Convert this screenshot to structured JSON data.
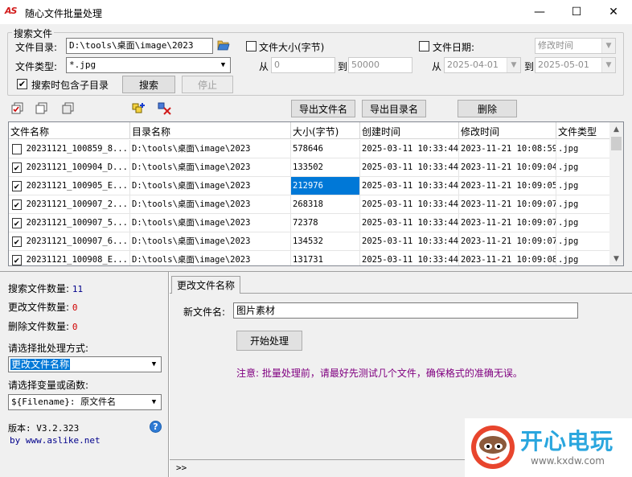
{
  "window": {
    "title": "随心文件批量处理",
    "app_icon_text": "AS",
    "minimize": "—",
    "maximize": "☐",
    "close": "✕"
  },
  "search_group": {
    "title": "搜索文件",
    "dir_label": "文件目录:",
    "dir_value": "D:\\tools\\桌面\\image\\2023",
    "type_label": "文件类型:",
    "type_value": "*.jpg",
    "subdir_label": "搜索时包含子目录",
    "subdir_checked": true,
    "search_button": "搜索",
    "stop_button": "停止",
    "size_label": "文件大小(字节)",
    "size_from_label": "从",
    "size_from_value": "0",
    "size_to_label": "到",
    "size_to_value": "50000",
    "date_label": "文件日期:",
    "date_mode_value": "修改时间",
    "date_from_label": "从",
    "date_from_value": "2025-04-01",
    "date_to_label": "到",
    "date_to_value": "2025-05-01"
  },
  "toolbar": {
    "export_files": "导出文件名",
    "export_dirs": "导出目录名",
    "delete": "删除"
  },
  "table": {
    "headers": [
      "文件名称",
      "目录名称",
      "大小(字节)",
      "创建时间",
      "修改时间",
      "文件类型"
    ],
    "rows": [
      {
        "checked": false,
        "name": "20231121_100859_8...",
        "dir": "D:\\tools\\桌面\\image\\2023",
        "size": "578646",
        "created": "2025-03-11 10:33:44",
        "modified": "2023-11-21 10:08:59",
        "type": ".jpg"
      },
      {
        "checked": true,
        "name": "20231121_100904_D...",
        "dir": "D:\\tools\\桌面\\image\\2023",
        "size": "133502",
        "created": "2025-03-11 10:33:44",
        "modified": "2023-11-21 10:09:04",
        "type": ".jpg"
      },
      {
        "checked": true,
        "name": "20231121_100905_E...",
        "dir": "D:\\tools\\桌面\\image\\2023",
        "size": "212976",
        "created": "2025-03-11 10:33:44",
        "modified": "2023-11-21 10:09:05",
        "type": ".jpg"
      },
      {
        "checked": true,
        "name": "20231121_100907_2...",
        "dir": "D:\\tools\\桌面\\image\\2023",
        "size": "268318",
        "created": "2025-03-11 10:33:44",
        "modified": "2023-11-21 10:09:07",
        "type": ".jpg"
      },
      {
        "checked": true,
        "name": "20231121_100907_5...",
        "dir": "D:\\tools\\桌面\\image\\2023",
        "size": "72378",
        "created": "2025-03-11 10:33:44",
        "modified": "2023-11-21 10:09:07",
        "type": ".jpg"
      },
      {
        "checked": true,
        "name": "20231121_100907_6...",
        "dir": "D:\\tools\\桌面\\image\\2023",
        "size": "134532",
        "created": "2025-03-11 10:33:44",
        "modified": "2023-11-21 10:09:07",
        "type": ".jpg"
      },
      {
        "checked": true,
        "name": "20231121_100908_E...",
        "dir": "D:\\tools\\桌面\\image\\2023",
        "size": "131731",
        "created": "2025-03-11 10:33:44",
        "modified": "2023-11-21 10:09:08",
        "type": ".jpg"
      }
    ]
  },
  "stats": {
    "searched_label": "搜索文件数量:",
    "searched_value": "11",
    "renamed_label": "更改文件数量:",
    "renamed_value": "0",
    "deleted_label": "删除文件数量:",
    "deleted_value": "0"
  },
  "batch": {
    "mode_label": "请选择批处理方式:",
    "mode_value": "更改文件名称",
    "var_label": "请选择变量或函数:",
    "var_value": "${Filename}: 原文件名"
  },
  "about": {
    "version": "版本: V3.2.323",
    "by": "by www.aslike.net"
  },
  "tab": {
    "label": "更改文件名称",
    "new_name_label": "新文件名:",
    "new_name_value": "图片素材",
    "start_button": "开始处理",
    "note": "注意: 批量处理前，请最好先测试几个文件，确保格式的准确无误。"
  },
  "statusbar": {
    "expand": ">>"
  },
  "watermark": {
    "text": "开心电玩",
    "sub": "www.kxdw.com"
  }
}
